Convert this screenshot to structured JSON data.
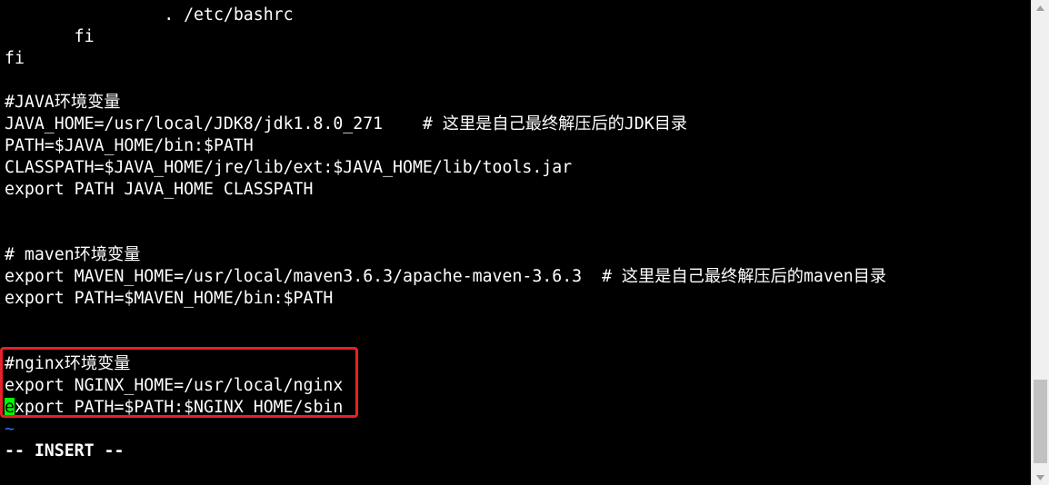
{
  "editor": {
    "mode": "vim",
    "lines": [
      "                . /etc/bashrc",
      "       fi",
      "fi",
      "",
      "#JAVA环境变量",
      "JAVA_HOME=/usr/local/JDK8/jdk1.8.0_271    # 这里是自己最终解压后的JDK目录",
      "PATH=$JAVA_HOME/bin:$PATH",
      "CLASSPATH=$JAVA_HOME/jre/lib/ext:$JAVA_HOME/lib/tools.jar",
      "export PATH JAVA_HOME CLASSPATH",
      "",
      "",
      "# maven环境变量",
      "export MAVEN_HOME=/usr/local/maven3.6.3/apache-maven-3.6.3  # 这里是自己最终解压后的maven目录",
      "export PATH=$MAVEN_HOME/bin:$PATH",
      "",
      "",
      "#nginx环境变量",
      "export NGINX_HOME=/usr/local/nginx"
    ],
    "cursor_line": {
      "cursor_char": "e",
      "rest": "xport PATH=$PATH:$NGINX_HOME/sbin"
    },
    "tilde": "~",
    "status_line": "-- INSERT --"
  },
  "colors": {
    "background": "#000000",
    "text": "#ffffff",
    "cursor": "#00ff00",
    "tilde": "#3b6cff",
    "highlight_border": "#e8202a",
    "scrollbar_track": "#f0f0f0",
    "scrollbar_thumb": "#c1c1c1"
  },
  "icons": {
    "scroll_up": "triangle-up-icon",
    "scroll_down": "triangle-down-icon"
  }
}
